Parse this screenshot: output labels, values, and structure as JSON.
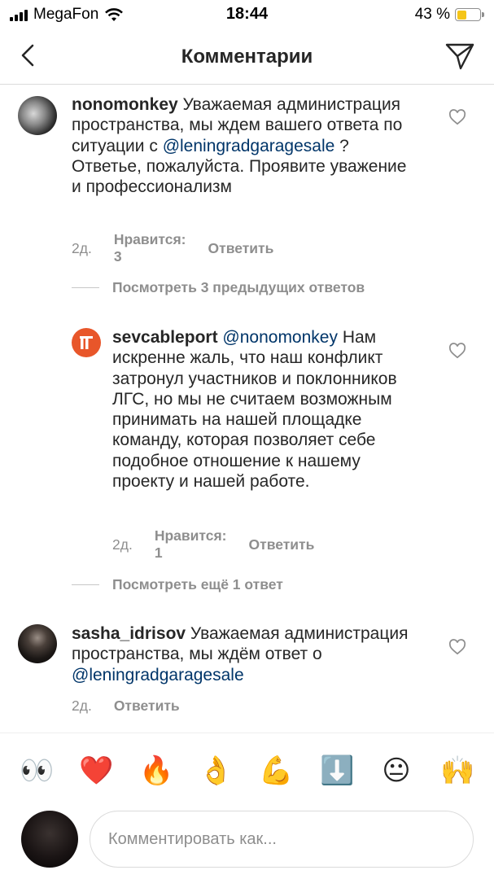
{
  "status_bar": {
    "carrier": "MegaFon",
    "time": "18:44",
    "battery": "43 %",
    "battery_level": 0.43
  },
  "header": {
    "title": "Комментарии",
    "back_icon": "chevron-left-icon",
    "share_icon": "paper-plane-icon"
  },
  "comments": [
    {
      "username": "nonomonkey",
      "text_pre": " Уважаемая администрация пространства, мы ждем вашего ответа по ситуации с ",
      "mention": "@leningradgaragesale",
      "text_post": " ? Ответье, пожалуйста. Проявите уважение и профессионализм",
      "time": "2д.",
      "likes": "Нравится: 3",
      "reply": "Ответить"
    },
    {
      "username": "sevcableport",
      "mention": "@nonomonkey",
      "text_post": " Нам искренне жаль, что наш конфликт затронул участников и поклонников ЛГС, но мы не считаем возможным принимать на нашей площадке команду, которая позволяет себе подобное отношение к нашему проекту и нашей работе.",
      "time": "2д.",
      "likes": "Нравится: 1",
      "reply": "Ответить"
    },
    {
      "username": "sasha_idrisov",
      "text_pre": " Уважаемая администрация пространства, мы ждём ответ о ",
      "mention": "@leningradgaragesale",
      "time": "2д.",
      "reply": "Ответить"
    }
  ],
  "view_replies": [
    "Посмотреть 3 предыдущих ответов",
    "Посмотреть ещё 1 ответ"
  ],
  "emoji_bar": [
    "👀",
    "❤️",
    "🔥",
    "👌",
    "💪",
    "⬇️",
    "😐",
    "🙌"
  ],
  "composer": {
    "placeholder": "Комментировать как..."
  },
  "colors": {
    "text": "#262626",
    "secondary": "#8e8e8e",
    "mention": "#003569",
    "divider": "#dbdbdb",
    "battery": "#f5c518",
    "sevcableport_brand": "#e8562a"
  }
}
